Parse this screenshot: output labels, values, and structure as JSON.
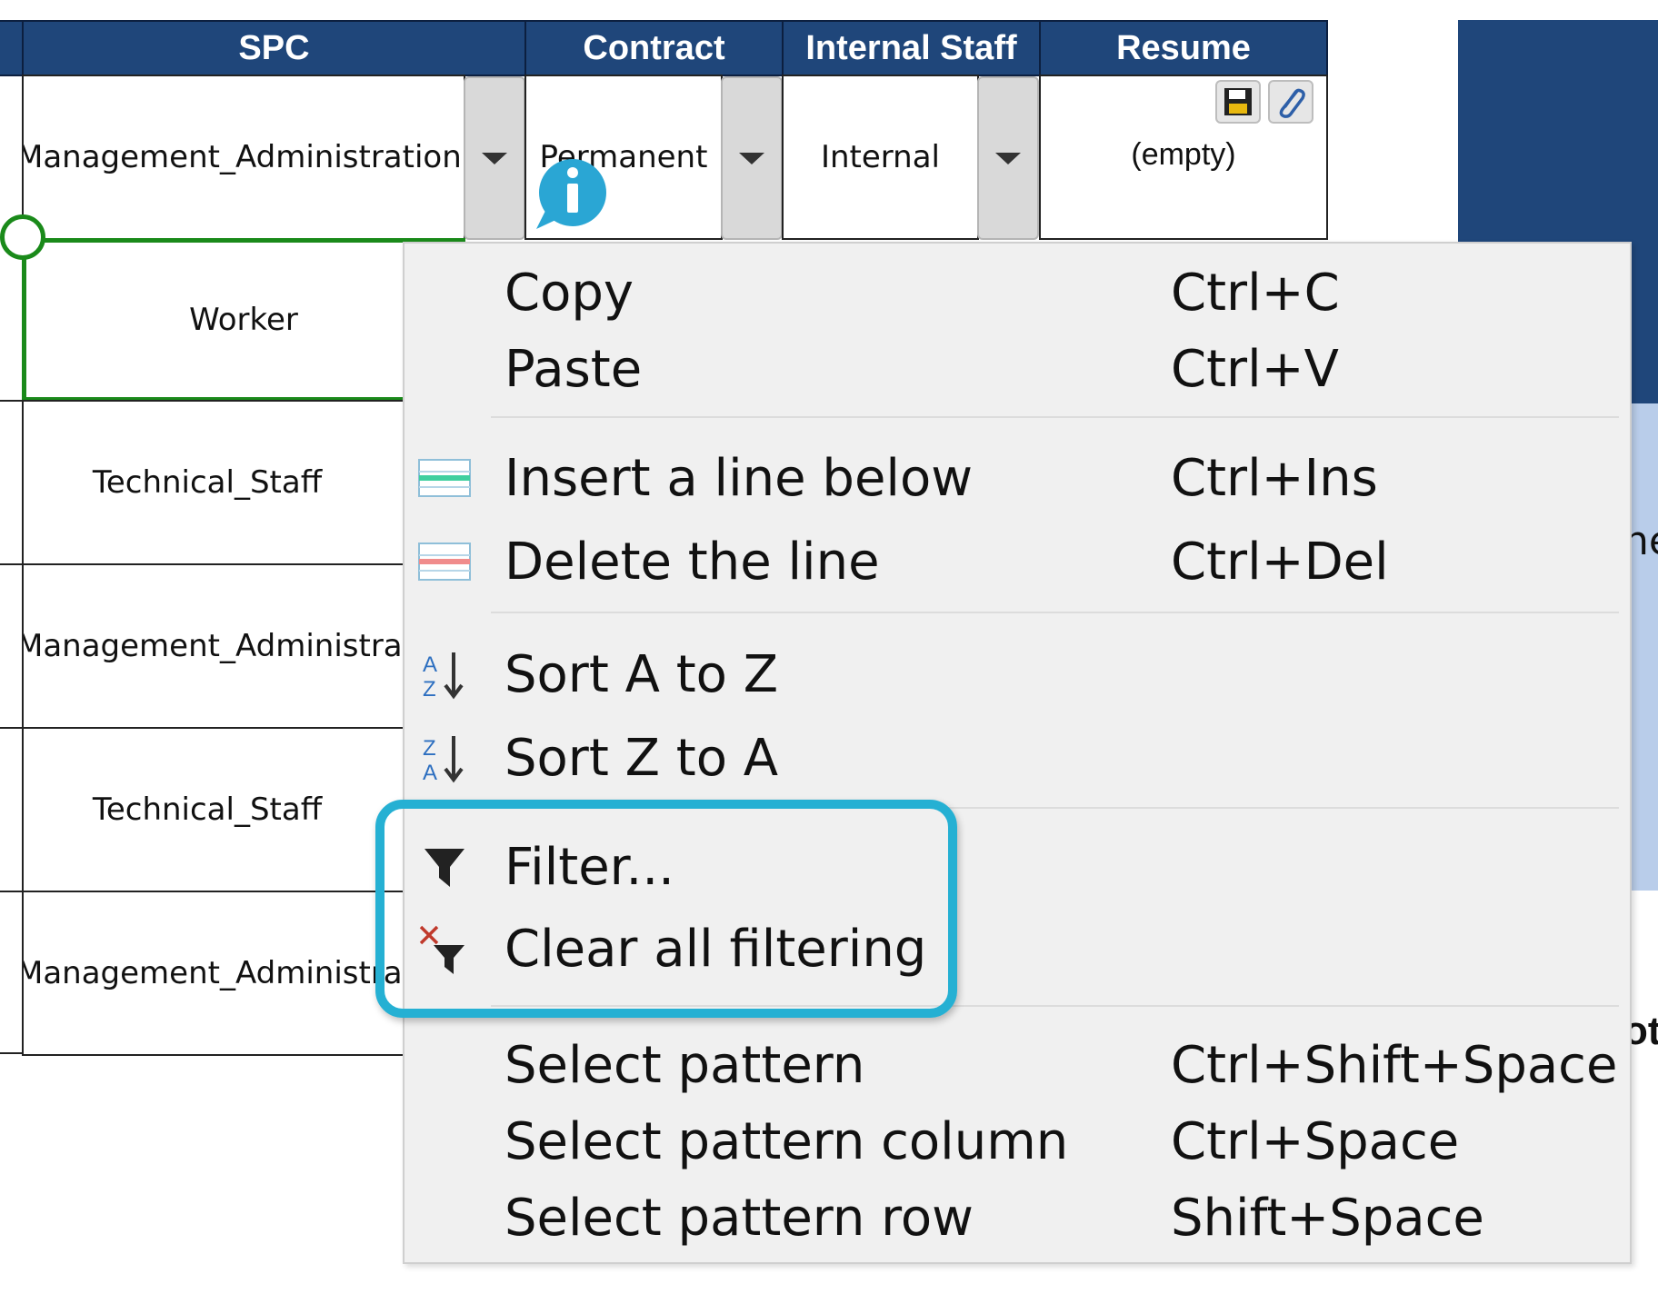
{
  "table": {
    "headers": {
      "spc": "SPC",
      "contract": "Contract",
      "internal_staff": "Internal Staff",
      "resume": "Resume"
    },
    "row1": {
      "spc": "Management_Administration",
      "contract": "Permanent",
      "internal_staff": "Internal",
      "resume": "(empty)"
    },
    "rows": [
      {
        "spc": "Worker"
      },
      {
        "spc": "Technical_Staff"
      },
      {
        "spc": "Management_Administration"
      },
      {
        "spc": "Technical_Staff"
      },
      {
        "spc": "Management_Administration"
      }
    ],
    "right_fragments": {
      "a": "ne",
      "b": "ot"
    }
  },
  "context_menu": {
    "copy": {
      "label": "Copy",
      "shortcut": "Ctrl+C"
    },
    "paste": {
      "label": "Paste",
      "shortcut": "Ctrl+V"
    },
    "insert_line": {
      "label": "Insert a line below",
      "shortcut": "Ctrl+Ins",
      "icon": "insert-row-icon"
    },
    "delete_line": {
      "label": "Delete the line",
      "shortcut": "Ctrl+Del",
      "icon": "delete-row-icon"
    },
    "sort_az": {
      "label": "Sort A to Z",
      "icon": "sort-az-icon"
    },
    "sort_za": {
      "label": "Sort Z to A",
      "icon": "sort-za-icon"
    },
    "filter": {
      "label": "Filter...",
      "icon": "funnel-icon"
    },
    "clear_filter": {
      "label": "Clear all filtering",
      "icon": "clear-filter-icon"
    },
    "select_pattern": {
      "label": "Select pattern",
      "shortcut": "Ctrl+Shift+Space"
    },
    "select_pattern_column": {
      "label": "Select pattern column",
      "shortcut": "Ctrl+Space"
    },
    "select_pattern_row": {
      "label": "Select pattern row",
      "shortcut": "Shift+Space"
    }
  },
  "colors": {
    "header_bg": "#1f467a",
    "highlight": "#25b0d3",
    "selection": "#1a8a1a"
  }
}
